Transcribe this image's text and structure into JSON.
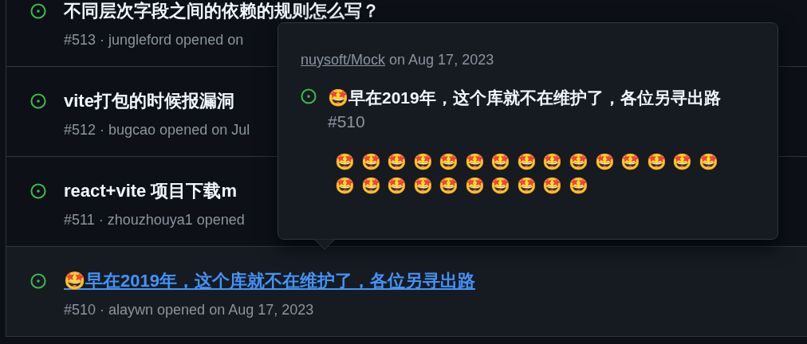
{
  "issues": [
    {
      "title": "不同层次字段之间的依赖的规则怎么写？",
      "meta": "#513 · jungleford opened on",
      "open": true,
      "hovered": false
    },
    {
      "title": "vite打包的时候报漏洞",
      "meta": "#512 · bugcao opened on Jul",
      "open": true,
      "hovered": false
    },
    {
      "title": "react+vite 项目下载m",
      "meta": "#511 · zhouzhouya1 opened",
      "open": true,
      "hovered": false
    },
    {
      "title": "🤩早在2019年，这个库就不在维护了，各位另寻出路",
      "meta": "#510 · alaywn opened on Aug 17, 2023",
      "open": true,
      "hovered": true
    }
  ],
  "popover": {
    "repo": "nuysoft/Mock",
    "date": "on Aug 17, 2023",
    "open": true,
    "title": "🤩早在2019年，这个库就不在维护了，各位另寻出路",
    "number": "#510",
    "body": "🤩 🤩 🤩 🤩 🤩 🤩 🤩 🤩 🤩 🤩 🤩 🤩 🤩 🤩 🤩 🤩 🤩 🤩 🤩 🤩 🤩 🤩 🤩 🤩 🤩"
  }
}
